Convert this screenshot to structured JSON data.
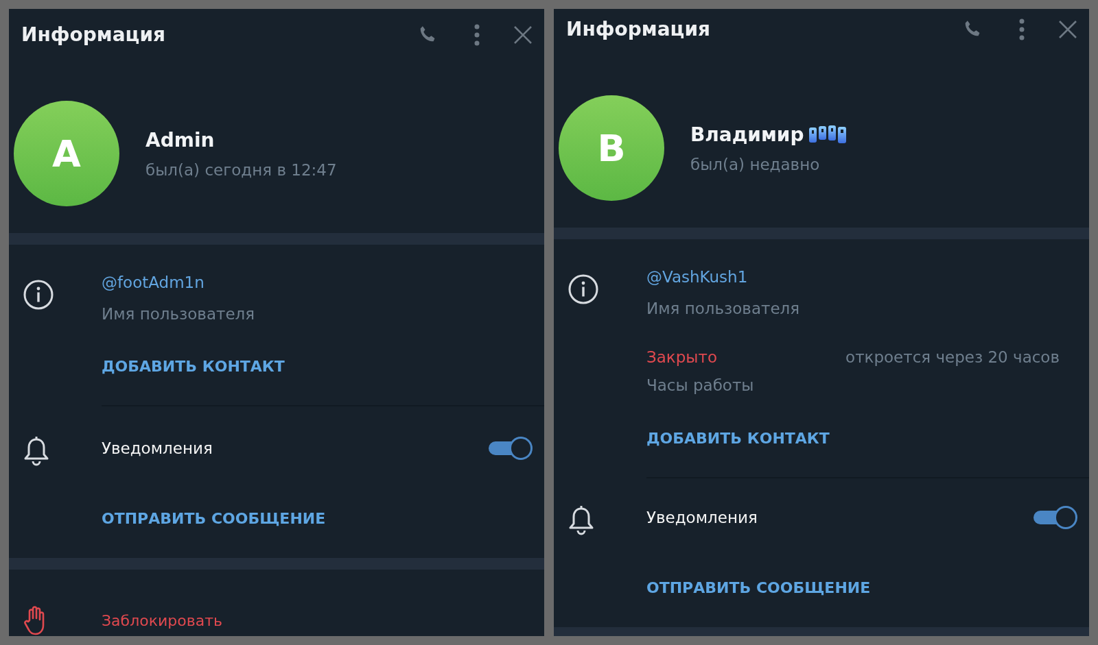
{
  "panels": [
    {
      "header": {
        "title": "Информация"
      },
      "profile": {
        "avatar_letter": "A",
        "name": "Admin",
        "status": "был(а) сегодня в 12:47",
        "emoji_status": false
      },
      "info": {
        "username": "@footAdm1n",
        "username_label": "Имя пользователя",
        "add_contact": "ДОБАВИТЬ КОНТАКТ"
      },
      "notifications": {
        "label": "Уведомления",
        "on": true
      },
      "send_message": "ОТПРАВИТЬ СООБЩЕНИЕ",
      "block": "Заблокировать"
    },
    {
      "header": {
        "title": "Информация"
      },
      "profile": {
        "avatar_letter": "В",
        "name": "Владимир",
        "status": "был(а) недавно",
        "emoji_status": true
      },
      "info": {
        "username": "@VashKush1",
        "username_label": "Имя пользователя",
        "hours": {
          "status": "Закрыто",
          "note": "откроется через 20 часов",
          "label": "Часы работы"
        },
        "add_contact": "ДОБАВИТЬ КОНТАКТ"
      },
      "notifications": {
        "label": "Уведомления",
        "on": true
      },
      "send_message": "ОТПРАВИТЬ СООБЩЕНИЕ"
    }
  ]
}
